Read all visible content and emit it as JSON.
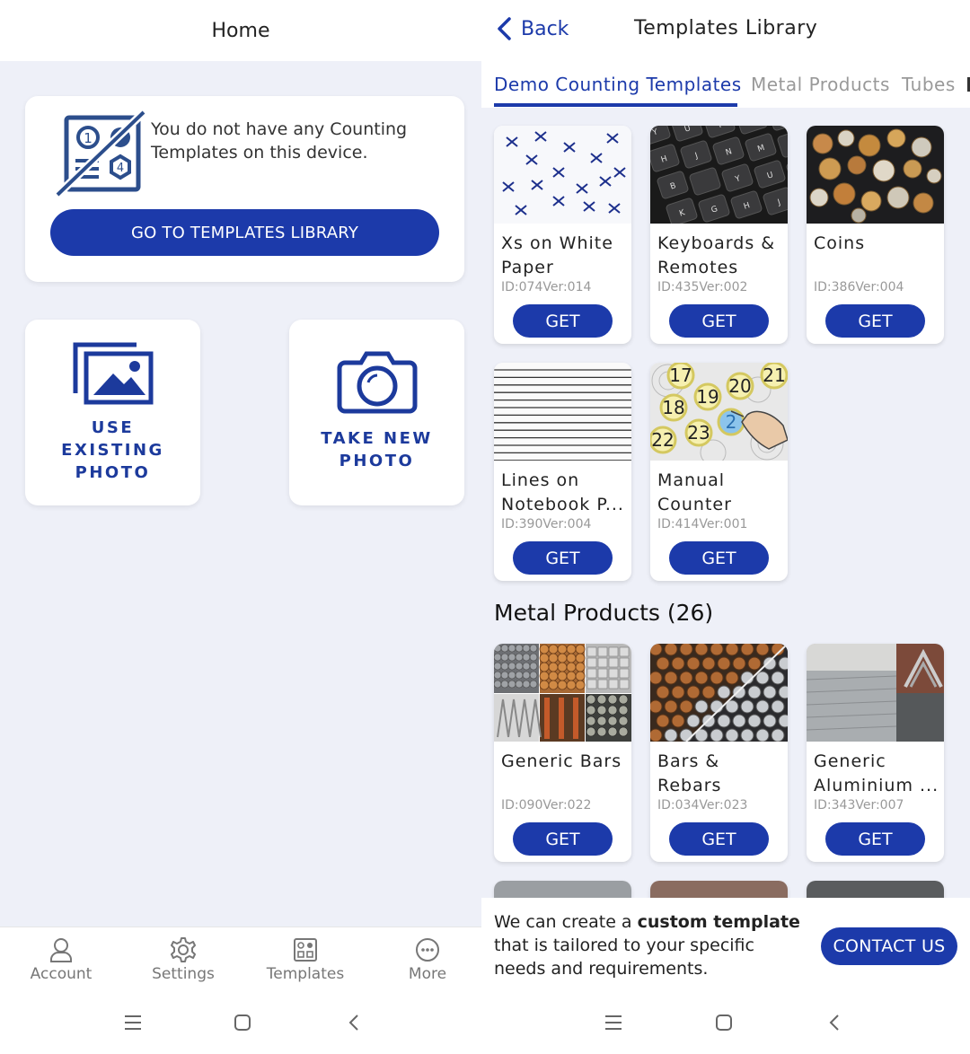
{
  "home": {
    "title": "Home",
    "empty_message": "You do not have any Counting Templates on this device.",
    "go_button": "GO TO TEMPLATES LIBRARY",
    "use_existing_label": "USE\nEXISTING\nPHOTO",
    "take_new_label": "TAKE NEW\nPHOTO",
    "nav": [
      {
        "label": "Account",
        "icon": "person-icon"
      },
      {
        "label": "Settings",
        "icon": "gear-icon"
      },
      {
        "label": "Templates",
        "icon": "templates-grid-icon"
      },
      {
        "label": "More",
        "icon": "more-dots-icon"
      }
    ]
  },
  "library": {
    "back_label": "Back",
    "title": "Templates Library",
    "tabs": [
      "Demo Counting Templates",
      "Metal Products",
      "Tubes"
    ],
    "active_tab": "Demo Counting Templates",
    "demo_cards": [
      {
        "name": "Xs on White Paper",
        "id": "ID:074Ver:014",
        "button": "GET",
        "thumb": "x-marks"
      },
      {
        "name": "Keyboards & Remotes",
        "id": "ID:435Ver:002",
        "button": "GET",
        "thumb": "keyboard"
      },
      {
        "name": "Coins",
        "id": "ID:386Ver:004",
        "button": "GET",
        "thumb": "coins"
      },
      {
        "name": "Lines on Notebook P...",
        "id": "ID:390Ver:004",
        "button": "GET",
        "thumb": "lines"
      },
      {
        "name": "Manual Counter",
        "id": "ID:414Ver:001",
        "button": "GET",
        "thumb": "manual-counter"
      }
    ],
    "manual_counter_numbers": [
      "17",
      "20",
      "21",
      "19",
      "18",
      "22",
      "23",
      "2"
    ],
    "section_metal": "Metal Products (26)",
    "metal_cards": [
      {
        "name": "Generic Bars",
        "id": "ID:090Ver:022",
        "button": "GET",
        "thumb": "bars-collage"
      },
      {
        "name": "Bars & Rebars",
        "id": "ID:034Ver:023",
        "button": "GET",
        "thumb": "rebars"
      },
      {
        "name": "Generic Aluminium ...",
        "id": "ID:343Ver:007",
        "button": "GET",
        "thumb": "aluminium"
      }
    ],
    "footer": {
      "text_before": "We can create a ",
      "text_bold": "custom template",
      "text_after": " that is tailored to your specific needs and requirements.",
      "contact_button": "CONTACT US"
    }
  },
  "colors": {
    "accent": "#1c3aaa",
    "background": "#eef0f8",
    "icon_blue": "#2c4e8c"
  }
}
